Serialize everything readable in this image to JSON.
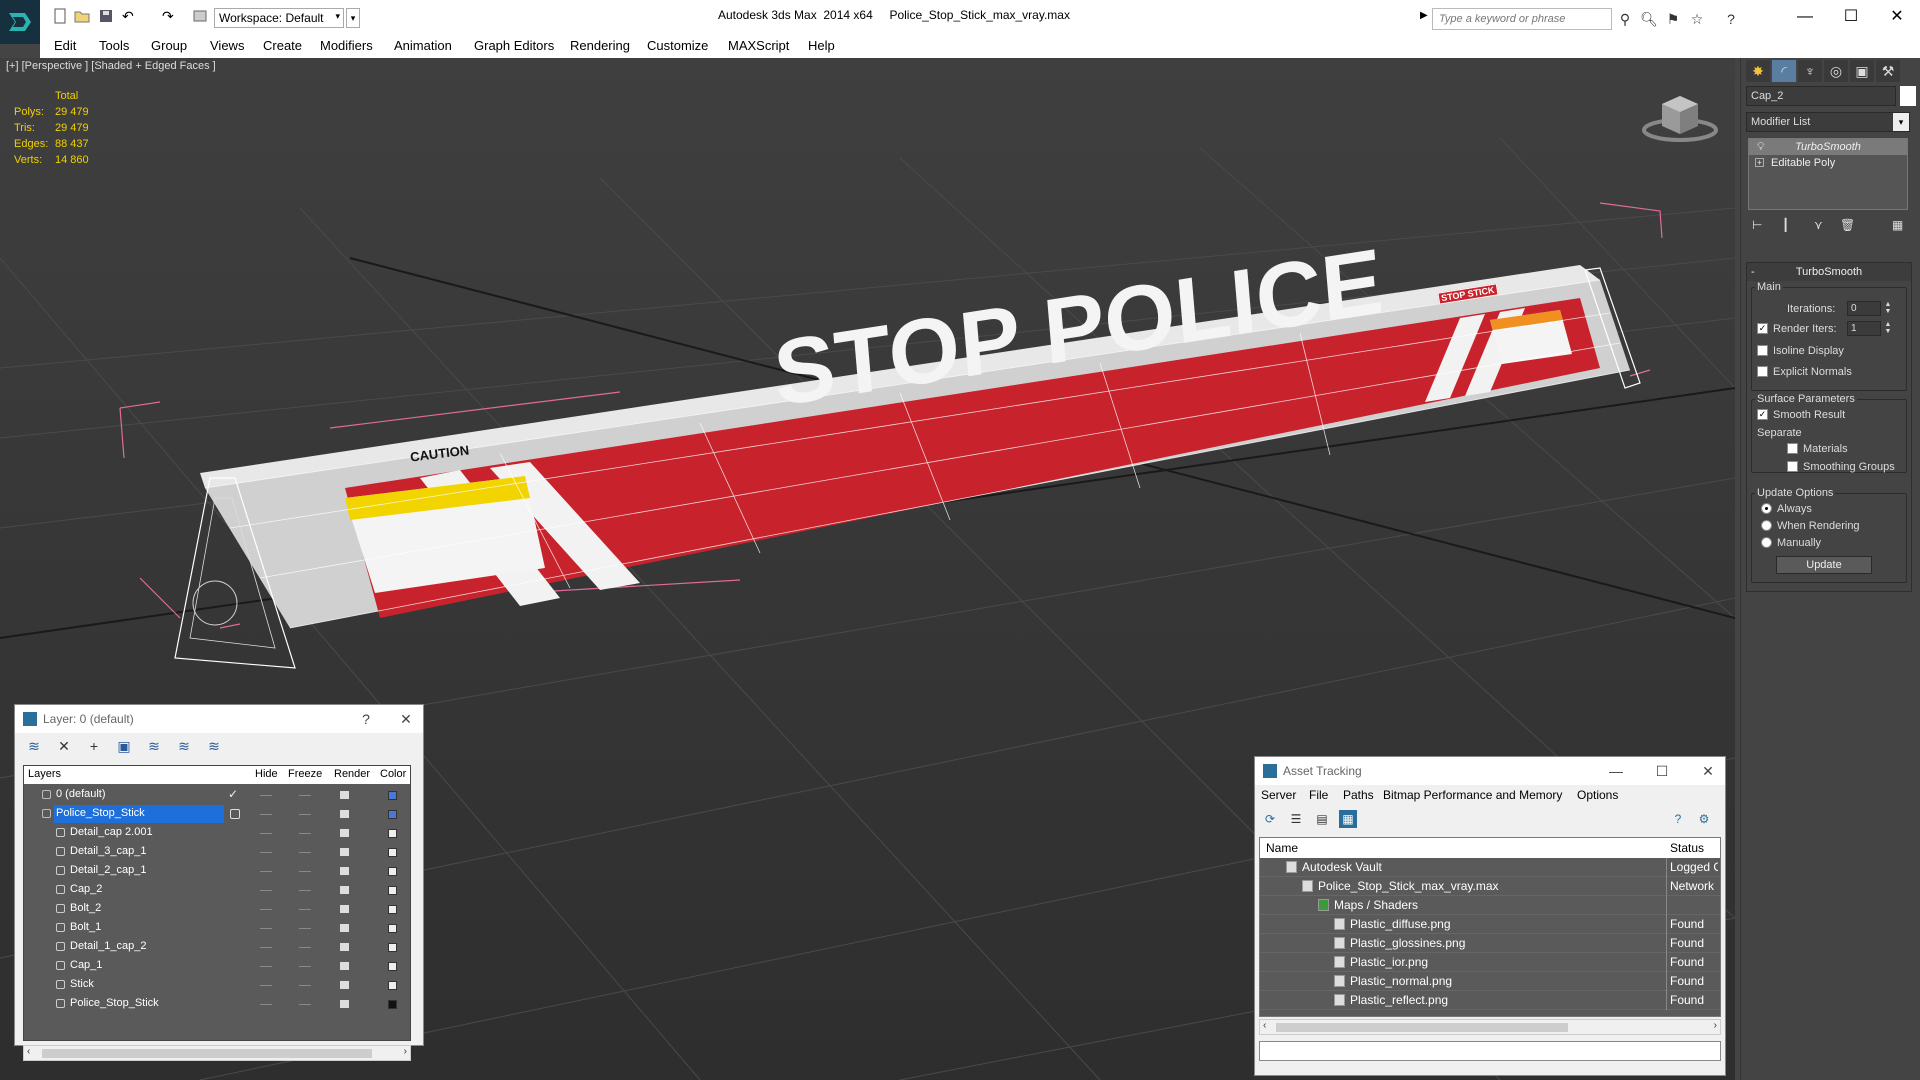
{
  "window": {
    "app_name": "Autodesk 3ds Max  2014 x64",
    "file_name": "Police_Stop_Stick_max_vray.max",
    "workspace": "Workspace: Default",
    "search_placeholder": "Type a keyword or phrase"
  },
  "menu": [
    "Edit",
    "Tools",
    "Group",
    "Views",
    "Create",
    "Modifiers",
    "Animation",
    "Graph Editors",
    "Rendering",
    "Customize",
    "MAXScript",
    "Help"
  ],
  "viewport": {
    "label": "[+] [Perspective ] [Shaded + Edged Faces ]",
    "stats_header": "Total",
    "stats": [
      {
        "key": "Polys:",
        "value": "29 479"
      },
      {
        "key": "Tris:",
        "value": "29 479"
      },
      {
        "key": "Edges:",
        "value": "88 437"
      },
      {
        "key": "Verts:",
        "value": "14 860"
      }
    ],
    "model_text": "STOP POLICE",
    "caution_text": "CAUTION",
    "stop_stick_text": "STOP STICK"
  },
  "command_panel": {
    "object_name": "Cap_2",
    "modifier_list": "Modifier List",
    "stack": [
      "TurboSmooth",
      "Editable Poly"
    ],
    "rollout_title": "TurboSmooth",
    "main_label": "Main",
    "iterations_label": "Iterations:",
    "iterations_value": "0",
    "render_iters_label": "Render Iters:",
    "render_iters_value": "1",
    "isoline_label": "Isoline Display",
    "explicit_normals_label": "Explicit Normals",
    "surface_params_label": "Surface Parameters",
    "smooth_result_label": "Smooth Result",
    "separate_label": "Separate",
    "materials_label": "Materials",
    "smoothing_groups_label": "Smoothing Groups",
    "update_options_label": "Update Options",
    "always_label": "Always",
    "when_rendering_label": "When Rendering",
    "manually_label": "Manually",
    "update_button": "Update"
  },
  "layer_panel": {
    "title": "Layer: 0 (default)",
    "help": "?",
    "columns": [
      "Layers",
      "Hide",
      "Freeze",
      "Render",
      "Color"
    ],
    "rows": [
      {
        "name": "0 (default)",
        "level": 0,
        "selected": false,
        "color": "#4a78d8"
      },
      {
        "name": "Police_Stop_Stick",
        "level": 0,
        "selected": true,
        "color": "#4a78d8"
      },
      {
        "name": "Detail_cap 2.001",
        "level": 1,
        "selected": false,
        "color": "#eeeeee"
      },
      {
        "name": "Detail_3_cap_1",
        "level": 1,
        "selected": false,
        "color": "#eeeeee"
      },
      {
        "name": "Detail_2_cap_1",
        "level": 1,
        "selected": false,
        "color": "#eeeeee"
      },
      {
        "name": "Cap_2",
        "level": 1,
        "selected": false,
        "color": "#eeeeee"
      },
      {
        "name": "Bolt_2",
        "level": 1,
        "selected": false,
        "color": "#eeeeee"
      },
      {
        "name": "Bolt_1",
        "level": 1,
        "selected": false,
        "color": "#eeeeee"
      },
      {
        "name": "Detail_1_cap_2",
        "level": 1,
        "selected": false,
        "color": "#eeeeee"
      },
      {
        "name": "Cap_1",
        "level": 1,
        "selected": false,
        "color": "#eeeeee"
      },
      {
        "name": "Stick",
        "level": 1,
        "selected": false,
        "color": "#eeeeee"
      },
      {
        "name": "Police_Stop_Stick",
        "level": 1,
        "selected": false,
        "color": "#111111"
      }
    ]
  },
  "asset_tracking": {
    "title": "Asset Tracking",
    "menu": [
      "Server",
      "File",
      "Paths",
      "Bitmap Performance and Memory",
      "Options"
    ],
    "columns": [
      "Name",
      "Status"
    ],
    "rows": [
      {
        "name": "Autodesk Vault",
        "status": "Logged O",
        "level": 1
      },
      {
        "name": "Police_Stop_Stick_max_vray.max",
        "status": "Network",
        "level": 2
      },
      {
        "name": "Maps / Shaders",
        "status": "",
        "level": 3
      },
      {
        "name": "Plastic_diffuse.png",
        "status": "Found",
        "level": 4
      },
      {
        "name": "Plastic_glossines.png",
        "status": "Found",
        "level": 4
      },
      {
        "name": "Plastic_ior.png",
        "status": "Found",
        "level": 4
      },
      {
        "name": "Plastic_normal.png",
        "status": "Found",
        "level": 4
      },
      {
        "name": "Plastic_reflect.png",
        "status": "Found",
        "level": 4
      }
    ]
  }
}
